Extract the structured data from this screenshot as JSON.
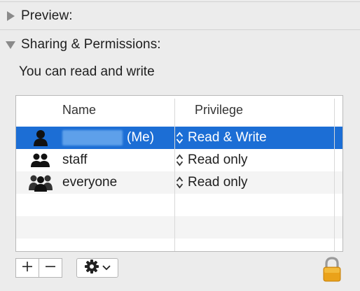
{
  "sections": {
    "preview": {
      "label": "Preview:",
      "expanded": false
    },
    "sharing": {
      "label": "Sharing & Permissions:",
      "expanded": true
    }
  },
  "access_summary": "You can read and write",
  "permissions_table": {
    "columns": [
      "Name",
      "Privilege"
    ],
    "rows": [
      {
        "icon": "single-user-icon",
        "name": "(Me)",
        "name_redacted": true,
        "privilege": "Read & Write",
        "selected": true
      },
      {
        "icon": "group-icon",
        "name": "staff",
        "name_redacted": false,
        "privilege": "Read only",
        "selected": false
      },
      {
        "icon": "everyone-icon",
        "name": "everyone",
        "name_redacted": false,
        "privilege": "Read only",
        "selected": false
      }
    ]
  },
  "toolbar": {
    "add_label": "+",
    "remove_label": "−",
    "action_icon": "gear-icon",
    "lock_icon": "lock-icon"
  },
  "colors": {
    "selection": "#1c6ed5",
    "background": "#ececec",
    "lock": "#e8a317"
  }
}
